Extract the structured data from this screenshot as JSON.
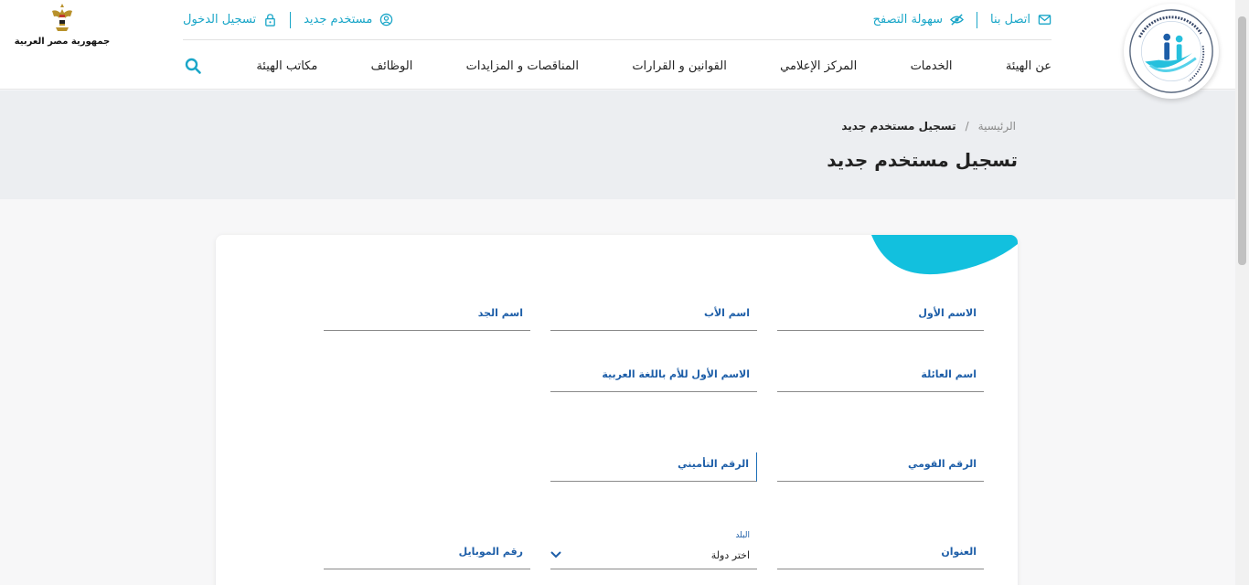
{
  "header": {
    "emblem_text": "جمهورية مصر العربية",
    "topbar": {
      "contact": "اتصل بنا",
      "accessibility": "سهولة التصفح",
      "new_user": "مستخدم جديد",
      "login": "تسجيل الدخول"
    },
    "nav": [
      "عن الهيئة",
      "الخدمات",
      "المركز الإعلامي",
      "القوانين و القرارات",
      "المناقصات و المزايدات",
      "الوظائف",
      "مكاتب الهيئة"
    ],
    "accent_color": "#1aa6c8"
  },
  "breadcrumb": {
    "home": "الرئيسية",
    "separator": "/",
    "current": "تسجيل مستخدم جديد"
  },
  "page_title": "تسجيل مستخدم جديد",
  "form": {
    "first_name": "الاسم الأول",
    "father_name": "اسم الأب",
    "grandfather_name": "اسم الجد",
    "family_name": "اسم العائلة",
    "mother_first_name_ar": "الاسم الأول للأم باللغة العربية",
    "national_id": "الرقم القومي",
    "insurance_number": "الرقم التأميني",
    "address": "العنوان",
    "country_label": "البلد",
    "country_value": "اختر دولة",
    "mobile": "رقم الموبايل"
  }
}
